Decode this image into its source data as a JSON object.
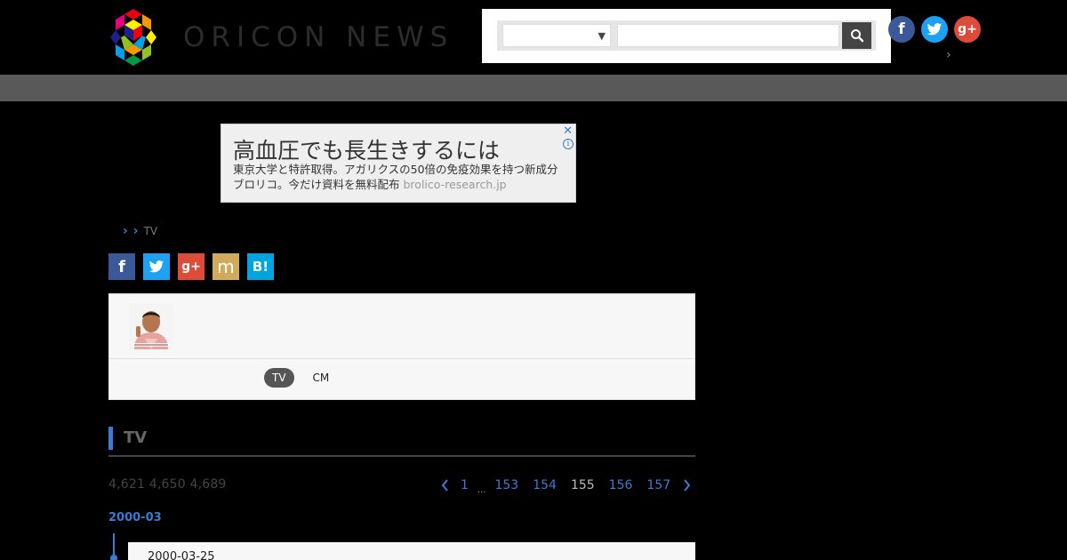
{
  "header": {
    "logo_text": "ORICON NEWS",
    "search": {
      "select_value": "",
      "input_value": "",
      "input_placeholder": ""
    },
    "chevron": "›"
  },
  "ad": {
    "headline": "高血圧でも長生きするには",
    "body_line1": "東京大学と特許取得。アガリクスの50倍の免疫効果を持つ新成分",
    "body_line2": "ブロリコ。今だけ資料を無料配布",
    "url": "brolico-research.jp",
    "close": "✕",
    "info": "i"
  },
  "breadcrumb": {
    "current": "TV"
  },
  "profile": {
    "tabs": [
      {
        "label": "TV",
        "active": true
      },
      {
        "label": "CM",
        "active": false
      }
    ]
  },
  "section": {
    "title": "TV",
    "counts": "4,621 4,650 4,689"
  },
  "pagination": {
    "pages": [
      "1",
      "153",
      "154",
      "156",
      "157"
    ],
    "current": "155",
    "ellipsis": "..."
  },
  "timeline": {
    "month": "2000-03",
    "entries": [
      {
        "date": "2000-03-25"
      }
    ]
  },
  "colors": {
    "accent": "#3a7bd5",
    "facebook": "#3b5998",
    "twitter": "#1da1f2",
    "google_plus": "#dd4b39",
    "mixi": "#d1aa5b",
    "hatena": "#00a4de"
  }
}
